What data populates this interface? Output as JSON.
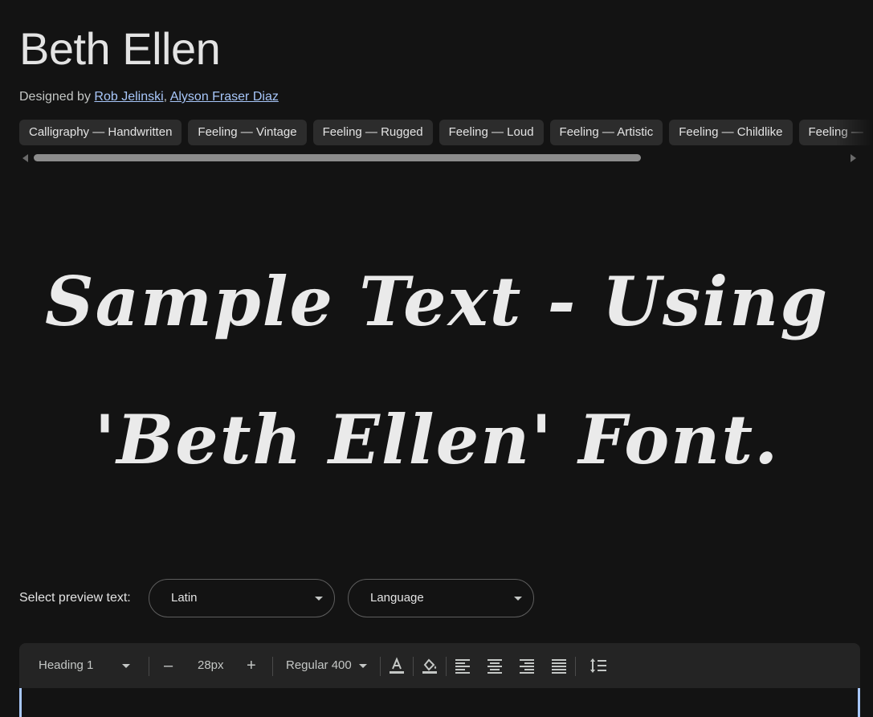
{
  "font": {
    "name": "Beth Ellen",
    "designed_by_label": "Designed by",
    "designers": [
      "Rob Jelinski",
      "Alyson Fraser Diaz"
    ],
    "designer_separator": ", "
  },
  "tags": [
    "Calligraphy — Handwritten",
    "Feeling — Vintage",
    "Feeling — Rugged",
    "Feeling — Loud",
    "Feeling — Artistic",
    "Feeling — Childlike",
    "Feeling —"
  ],
  "sample_text": "Sample Text - Using 'Beth Ellen' Font.",
  "preview": {
    "label": "Select preview text:",
    "script_value": "Latin",
    "language_placeholder": "Language"
  },
  "toolbar": {
    "style_value": "Heading 1",
    "size_value": "28px",
    "weight_value": "Regular 400",
    "decrease_glyph": "–",
    "increase_glyph": "+"
  },
  "colors": {
    "background": "#131313",
    "link": "#a8c7fa",
    "chip": "#2c2c2c",
    "toolbar": "#242424"
  },
  "icons": [
    "text-color-icon",
    "highlight-icon",
    "align-left-icon",
    "align-center-icon",
    "align-right-icon",
    "align-justify-icon",
    "line-height-icon",
    "chevron-down-icon"
  ]
}
